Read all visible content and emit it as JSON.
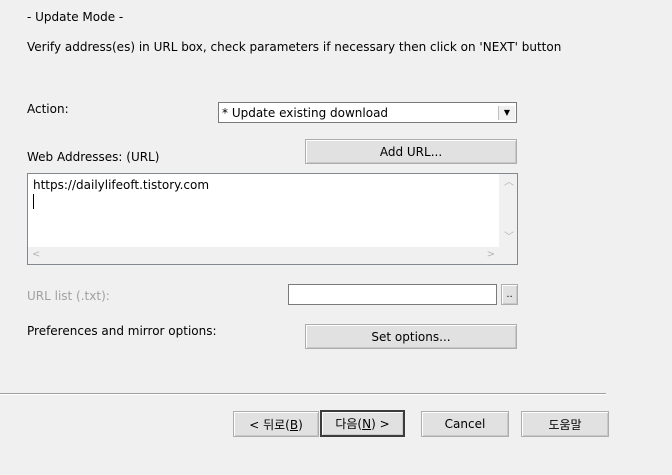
{
  "header": {
    "mode_title": "- Update Mode -",
    "instructions": "Verify address(es) in URL box, check parameters if necessary then click on 'NEXT' button"
  },
  "action": {
    "label": "Action:",
    "selected": "* Update existing download",
    "arrow_icon": "triangle-down"
  },
  "web_addresses": {
    "label": "Web Addresses: (URL)",
    "add_url_button": "Add URL...",
    "value": "https://dailylifeoft.tistory.com",
    "scroll_up_icon": "chevron-up",
    "scroll_down_icon": "chevron-down",
    "scroll_left_icon": "chevron-left",
    "scroll_right_icon": "chevron-right"
  },
  "url_list": {
    "label": "URL list (.txt):",
    "value": "",
    "browse_button": ".."
  },
  "preferences": {
    "label": "Preferences and mirror options:",
    "set_options_button": "Set options..."
  },
  "footer": {
    "back_button": "< 뒤로(",
    "back_mnemonic": "B",
    "back_close": ")",
    "next_button": "다음(",
    "next_mnemonic": "N",
    "next_close": ") >",
    "cancel_button": "Cancel",
    "help_button": "도움말"
  }
}
